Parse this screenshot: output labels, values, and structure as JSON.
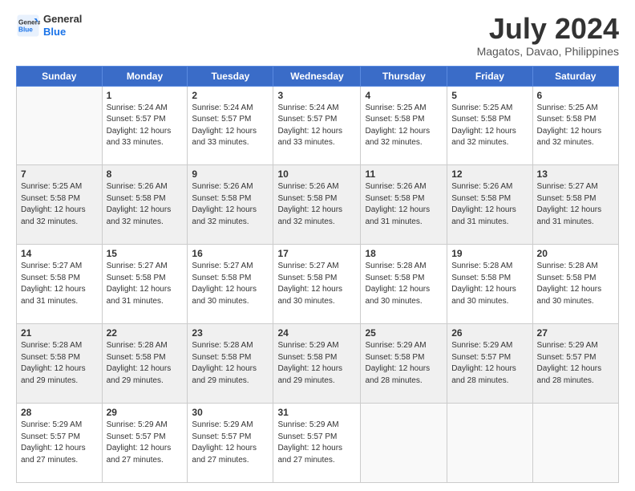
{
  "logo": {
    "text_general": "General",
    "text_blue": "Blue"
  },
  "header": {
    "title": "July 2024",
    "subtitle": "Magatos, Davao, Philippines"
  },
  "calendar": {
    "days_of_week": [
      "Sunday",
      "Monday",
      "Tuesday",
      "Wednesday",
      "Thursday",
      "Friday",
      "Saturday"
    ],
    "weeks": [
      {
        "shaded": false,
        "days": [
          {
            "num": "",
            "info": ""
          },
          {
            "num": "1",
            "info": "Sunrise: 5:24 AM\nSunset: 5:57 PM\nDaylight: 12 hours\nand 33 minutes."
          },
          {
            "num": "2",
            "info": "Sunrise: 5:24 AM\nSunset: 5:57 PM\nDaylight: 12 hours\nand 33 minutes."
          },
          {
            "num": "3",
            "info": "Sunrise: 5:24 AM\nSunset: 5:57 PM\nDaylight: 12 hours\nand 33 minutes."
          },
          {
            "num": "4",
            "info": "Sunrise: 5:25 AM\nSunset: 5:58 PM\nDaylight: 12 hours\nand 32 minutes."
          },
          {
            "num": "5",
            "info": "Sunrise: 5:25 AM\nSunset: 5:58 PM\nDaylight: 12 hours\nand 32 minutes."
          },
          {
            "num": "6",
            "info": "Sunrise: 5:25 AM\nSunset: 5:58 PM\nDaylight: 12 hours\nand 32 minutes."
          }
        ]
      },
      {
        "shaded": true,
        "days": [
          {
            "num": "7",
            "info": "Sunrise: 5:25 AM\nSunset: 5:58 PM\nDaylight: 12 hours\nand 32 minutes."
          },
          {
            "num": "8",
            "info": "Sunrise: 5:26 AM\nSunset: 5:58 PM\nDaylight: 12 hours\nand 32 minutes."
          },
          {
            "num": "9",
            "info": "Sunrise: 5:26 AM\nSunset: 5:58 PM\nDaylight: 12 hours\nand 32 minutes."
          },
          {
            "num": "10",
            "info": "Sunrise: 5:26 AM\nSunset: 5:58 PM\nDaylight: 12 hours\nand 32 minutes."
          },
          {
            "num": "11",
            "info": "Sunrise: 5:26 AM\nSunset: 5:58 PM\nDaylight: 12 hours\nand 31 minutes."
          },
          {
            "num": "12",
            "info": "Sunrise: 5:26 AM\nSunset: 5:58 PM\nDaylight: 12 hours\nand 31 minutes."
          },
          {
            "num": "13",
            "info": "Sunrise: 5:27 AM\nSunset: 5:58 PM\nDaylight: 12 hours\nand 31 minutes."
          }
        ]
      },
      {
        "shaded": false,
        "days": [
          {
            "num": "14",
            "info": "Sunrise: 5:27 AM\nSunset: 5:58 PM\nDaylight: 12 hours\nand 31 minutes."
          },
          {
            "num": "15",
            "info": "Sunrise: 5:27 AM\nSunset: 5:58 PM\nDaylight: 12 hours\nand 31 minutes."
          },
          {
            "num": "16",
            "info": "Sunrise: 5:27 AM\nSunset: 5:58 PM\nDaylight: 12 hours\nand 30 minutes."
          },
          {
            "num": "17",
            "info": "Sunrise: 5:27 AM\nSunset: 5:58 PM\nDaylight: 12 hours\nand 30 minutes."
          },
          {
            "num": "18",
            "info": "Sunrise: 5:28 AM\nSunset: 5:58 PM\nDaylight: 12 hours\nand 30 minutes."
          },
          {
            "num": "19",
            "info": "Sunrise: 5:28 AM\nSunset: 5:58 PM\nDaylight: 12 hours\nand 30 minutes."
          },
          {
            "num": "20",
            "info": "Sunrise: 5:28 AM\nSunset: 5:58 PM\nDaylight: 12 hours\nand 30 minutes."
          }
        ]
      },
      {
        "shaded": true,
        "days": [
          {
            "num": "21",
            "info": "Sunrise: 5:28 AM\nSunset: 5:58 PM\nDaylight: 12 hours\nand 29 minutes."
          },
          {
            "num": "22",
            "info": "Sunrise: 5:28 AM\nSunset: 5:58 PM\nDaylight: 12 hours\nand 29 minutes."
          },
          {
            "num": "23",
            "info": "Sunrise: 5:28 AM\nSunset: 5:58 PM\nDaylight: 12 hours\nand 29 minutes."
          },
          {
            "num": "24",
            "info": "Sunrise: 5:29 AM\nSunset: 5:58 PM\nDaylight: 12 hours\nand 29 minutes."
          },
          {
            "num": "25",
            "info": "Sunrise: 5:29 AM\nSunset: 5:58 PM\nDaylight: 12 hours\nand 28 minutes."
          },
          {
            "num": "26",
            "info": "Sunrise: 5:29 AM\nSunset: 5:57 PM\nDaylight: 12 hours\nand 28 minutes."
          },
          {
            "num": "27",
            "info": "Sunrise: 5:29 AM\nSunset: 5:57 PM\nDaylight: 12 hours\nand 28 minutes."
          }
        ]
      },
      {
        "shaded": false,
        "days": [
          {
            "num": "28",
            "info": "Sunrise: 5:29 AM\nSunset: 5:57 PM\nDaylight: 12 hours\nand 27 minutes."
          },
          {
            "num": "29",
            "info": "Sunrise: 5:29 AM\nSunset: 5:57 PM\nDaylight: 12 hours\nand 27 minutes."
          },
          {
            "num": "30",
            "info": "Sunrise: 5:29 AM\nSunset: 5:57 PM\nDaylight: 12 hours\nand 27 minutes."
          },
          {
            "num": "31",
            "info": "Sunrise: 5:29 AM\nSunset: 5:57 PM\nDaylight: 12 hours\nand 27 minutes."
          },
          {
            "num": "",
            "info": ""
          },
          {
            "num": "",
            "info": ""
          },
          {
            "num": "",
            "info": ""
          }
        ]
      }
    ]
  }
}
